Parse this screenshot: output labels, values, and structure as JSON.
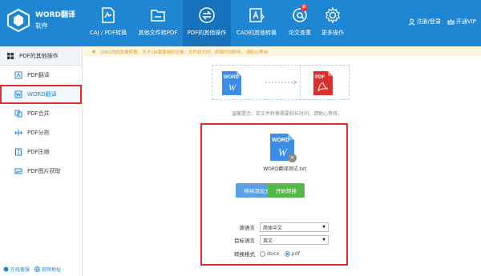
{
  "app": {
    "title": "WORD翻译",
    "subtitle": "软件"
  },
  "nav": [
    {
      "label": "CAJ / PDF转换",
      "icon": "pdf-convert-icon"
    },
    {
      "label": "其他文件转PDF",
      "icon": "folder-icon"
    },
    {
      "label": "PDF的其他操作",
      "icon": "swap-icon"
    },
    {
      "label": "CAD的其他转换",
      "icon": "cad-icon"
    },
    {
      "label": "论文查重",
      "icon": "at-icon",
      "badge": "新"
    },
    {
      "label": "更多操作",
      "icon": "gear-icon"
    }
  ],
  "user": {
    "login": "注册/登录",
    "vip": "开通VIP"
  },
  "sidebar": {
    "header": "PDF的其他操作",
    "items": [
      {
        "label": "PDF翻译",
        "icon": "translate-icon"
      },
      {
        "label": "WORD翻译",
        "icon": "word-translate-icon"
      },
      {
        "label": "PDF合并",
        "icon": "merge-icon"
      },
      {
        "label": "PDF分割",
        "icon": "split-icon"
      },
      {
        "label": "PDF压缩",
        "icon": "compress-icon"
      },
      {
        "label": "PDF图片获取",
        "icon": "image-icon"
      }
    ],
    "footer": {
      "online": "在线客服",
      "site": "官网地址"
    }
  },
  "notice": "1M以内的免费转换，大于1M需使用时注册，文件较大时，转换时间较长，请耐心等待",
  "conversion": {
    "from_label": "WORD",
    "from_glyph": "W",
    "to_label": "PDF"
  },
  "tip": "温馨提示：若文件转换需要较长时间，请耐心等待。",
  "panel": {
    "file_label": "WORD",
    "file_glyph": "W",
    "remove": "×",
    "file_name": "WORD翻译测试.txt",
    "add_button": "继续添加文件",
    "start_button": "开始转换",
    "source_lang_label": "源语言",
    "source_lang_value": "简体中文",
    "target_lang_label": "目标语言",
    "target_lang_value": "英文",
    "format_label": "转换格式",
    "format_options": [
      "docx",
      "pdf"
    ],
    "format_selected": "pdf"
  },
  "colors": {
    "primary": "#1f86d4",
    "primary_dark": "#1672bb",
    "highlight": "#d93030",
    "add_button": "#5b9ee3",
    "start_button": "#54b848",
    "pdf_red": "#d93030"
  }
}
